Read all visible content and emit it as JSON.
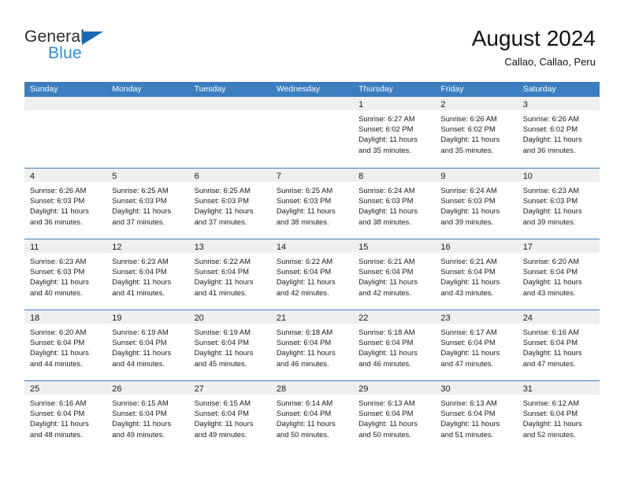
{
  "brand": {
    "name_part1": "General",
    "name_part2": "Blue",
    "color_primary": "#1b68b3",
    "color_secondary": "#2e8fd6"
  },
  "header": {
    "title": "August 2024",
    "subtitle": "Callao, Callao, Peru"
  },
  "theme": {
    "header_band": "#3c7ebf",
    "day_band": "#efefef",
    "row_rule": "#3c7ebf"
  },
  "weekdays": [
    "Sunday",
    "Monday",
    "Tuesday",
    "Wednesday",
    "Thursday",
    "Friday",
    "Saturday"
  ],
  "weeks": [
    [
      {
        "day": "",
        "sunrise": "",
        "sunset": "",
        "daylight_line1": "",
        "daylight_line2": ""
      },
      {
        "day": "",
        "sunrise": "",
        "sunset": "",
        "daylight_line1": "",
        "daylight_line2": ""
      },
      {
        "day": "",
        "sunrise": "",
        "sunset": "",
        "daylight_line1": "",
        "daylight_line2": ""
      },
      {
        "day": "",
        "sunrise": "",
        "sunset": "",
        "daylight_line1": "",
        "daylight_line2": ""
      },
      {
        "day": "1",
        "sunrise": "Sunrise: 6:27 AM",
        "sunset": "Sunset: 6:02 PM",
        "daylight_line1": "Daylight: 11 hours",
        "daylight_line2": "and 35 minutes."
      },
      {
        "day": "2",
        "sunrise": "Sunrise: 6:26 AM",
        "sunset": "Sunset: 6:02 PM",
        "daylight_line1": "Daylight: 11 hours",
        "daylight_line2": "and 35 minutes."
      },
      {
        "day": "3",
        "sunrise": "Sunrise: 6:26 AM",
        "sunset": "Sunset: 6:02 PM",
        "daylight_line1": "Daylight: 11 hours",
        "daylight_line2": "and 36 minutes."
      }
    ],
    [
      {
        "day": "4",
        "sunrise": "Sunrise: 6:26 AM",
        "sunset": "Sunset: 6:03 PM",
        "daylight_line1": "Daylight: 11 hours",
        "daylight_line2": "and 36 minutes."
      },
      {
        "day": "5",
        "sunrise": "Sunrise: 6:25 AM",
        "sunset": "Sunset: 6:03 PM",
        "daylight_line1": "Daylight: 11 hours",
        "daylight_line2": "and 37 minutes."
      },
      {
        "day": "6",
        "sunrise": "Sunrise: 6:25 AM",
        "sunset": "Sunset: 6:03 PM",
        "daylight_line1": "Daylight: 11 hours",
        "daylight_line2": "and 37 minutes."
      },
      {
        "day": "7",
        "sunrise": "Sunrise: 6:25 AM",
        "sunset": "Sunset: 6:03 PM",
        "daylight_line1": "Daylight: 11 hours",
        "daylight_line2": "and 38 minutes."
      },
      {
        "day": "8",
        "sunrise": "Sunrise: 6:24 AM",
        "sunset": "Sunset: 6:03 PM",
        "daylight_line1": "Daylight: 11 hours",
        "daylight_line2": "and 38 minutes."
      },
      {
        "day": "9",
        "sunrise": "Sunrise: 6:24 AM",
        "sunset": "Sunset: 6:03 PM",
        "daylight_line1": "Daylight: 11 hours",
        "daylight_line2": "and 39 minutes."
      },
      {
        "day": "10",
        "sunrise": "Sunrise: 6:23 AM",
        "sunset": "Sunset: 6:03 PM",
        "daylight_line1": "Daylight: 11 hours",
        "daylight_line2": "and 39 minutes."
      }
    ],
    [
      {
        "day": "11",
        "sunrise": "Sunrise: 6:23 AM",
        "sunset": "Sunset: 6:03 PM",
        "daylight_line1": "Daylight: 11 hours",
        "daylight_line2": "and 40 minutes."
      },
      {
        "day": "12",
        "sunrise": "Sunrise: 6:23 AM",
        "sunset": "Sunset: 6:04 PM",
        "daylight_line1": "Daylight: 11 hours",
        "daylight_line2": "and 41 minutes."
      },
      {
        "day": "13",
        "sunrise": "Sunrise: 6:22 AM",
        "sunset": "Sunset: 6:04 PM",
        "daylight_line1": "Daylight: 11 hours",
        "daylight_line2": "and 41 minutes."
      },
      {
        "day": "14",
        "sunrise": "Sunrise: 6:22 AM",
        "sunset": "Sunset: 6:04 PM",
        "daylight_line1": "Daylight: 11 hours",
        "daylight_line2": "and 42 minutes."
      },
      {
        "day": "15",
        "sunrise": "Sunrise: 6:21 AM",
        "sunset": "Sunset: 6:04 PM",
        "daylight_line1": "Daylight: 11 hours",
        "daylight_line2": "and 42 minutes."
      },
      {
        "day": "16",
        "sunrise": "Sunrise: 6:21 AM",
        "sunset": "Sunset: 6:04 PM",
        "daylight_line1": "Daylight: 11 hours",
        "daylight_line2": "and 43 minutes."
      },
      {
        "day": "17",
        "sunrise": "Sunrise: 6:20 AM",
        "sunset": "Sunset: 6:04 PM",
        "daylight_line1": "Daylight: 11 hours",
        "daylight_line2": "and 43 minutes."
      }
    ],
    [
      {
        "day": "18",
        "sunrise": "Sunrise: 6:20 AM",
        "sunset": "Sunset: 6:04 PM",
        "daylight_line1": "Daylight: 11 hours",
        "daylight_line2": "and 44 minutes."
      },
      {
        "day": "19",
        "sunrise": "Sunrise: 6:19 AM",
        "sunset": "Sunset: 6:04 PM",
        "daylight_line1": "Daylight: 11 hours",
        "daylight_line2": "and 44 minutes."
      },
      {
        "day": "20",
        "sunrise": "Sunrise: 6:19 AM",
        "sunset": "Sunset: 6:04 PM",
        "daylight_line1": "Daylight: 11 hours",
        "daylight_line2": "and 45 minutes."
      },
      {
        "day": "21",
        "sunrise": "Sunrise: 6:18 AM",
        "sunset": "Sunset: 6:04 PM",
        "daylight_line1": "Daylight: 11 hours",
        "daylight_line2": "and 46 minutes."
      },
      {
        "day": "22",
        "sunrise": "Sunrise: 6:18 AM",
        "sunset": "Sunset: 6:04 PM",
        "daylight_line1": "Daylight: 11 hours",
        "daylight_line2": "and 46 minutes."
      },
      {
        "day": "23",
        "sunrise": "Sunrise: 6:17 AM",
        "sunset": "Sunset: 6:04 PM",
        "daylight_line1": "Daylight: 11 hours",
        "daylight_line2": "and 47 minutes."
      },
      {
        "day": "24",
        "sunrise": "Sunrise: 6:16 AM",
        "sunset": "Sunset: 6:04 PM",
        "daylight_line1": "Daylight: 11 hours",
        "daylight_line2": "and 47 minutes."
      }
    ],
    [
      {
        "day": "25",
        "sunrise": "Sunrise: 6:16 AM",
        "sunset": "Sunset: 6:04 PM",
        "daylight_line1": "Daylight: 11 hours",
        "daylight_line2": "and 48 minutes."
      },
      {
        "day": "26",
        "sunrise": "Sunrise: 6:15 AM",
        "sunset": "Sunset: 6:04 PM",
        "daylight_line1": "Daylight: 11 hours",
        "daylight_line2": "and 49 minutes."
      },
      {
        "day": "27",
        "sunrise": "Sunrise: 6:15 AM",
        "sunset": "Sunset: 6:04 PM",
        "daylight_line1": "Daylight: 11 hours",
        "daylight_line2": "and 49 minutes."
      },
      {
        "day": "28",
        "sunrise": "Sunrise: 6:14 AM",
        "sunset": "Sunset: 6:04 PM",
        "daylight_line1": "Daylight: 11 hours",
        "daylight_line2": "and 50 minutes."
      },
      {
        "day": "29",
        "sunrise": "Sunrise: 6:13 AM",
        "sunset": "Sunset: 6:04 PM",
        "daylight_line1": "Daylight: 11 hours",
        "daylight_line2": "and 50 minutes."
      },
      {
        "day": "30",
        "sunrise": "Sunrise: 6:13 AM",
        "sunset": "Sunset: 6:04 PM",
        "daylight_line1": "Daylight: 11 hours",
        "daylight_line2": "and 51 minutes."
      },
      {
        "day": "31",
        "sunrise": "Sunrise: 6:12 AM",
        "sunset": "Sunset: 6:04 PM",
        "daylight_line1": "Daylight: 11 hours",
        "daylight_line2": "and 52 minutes."
      }
    ]
  ]
}
